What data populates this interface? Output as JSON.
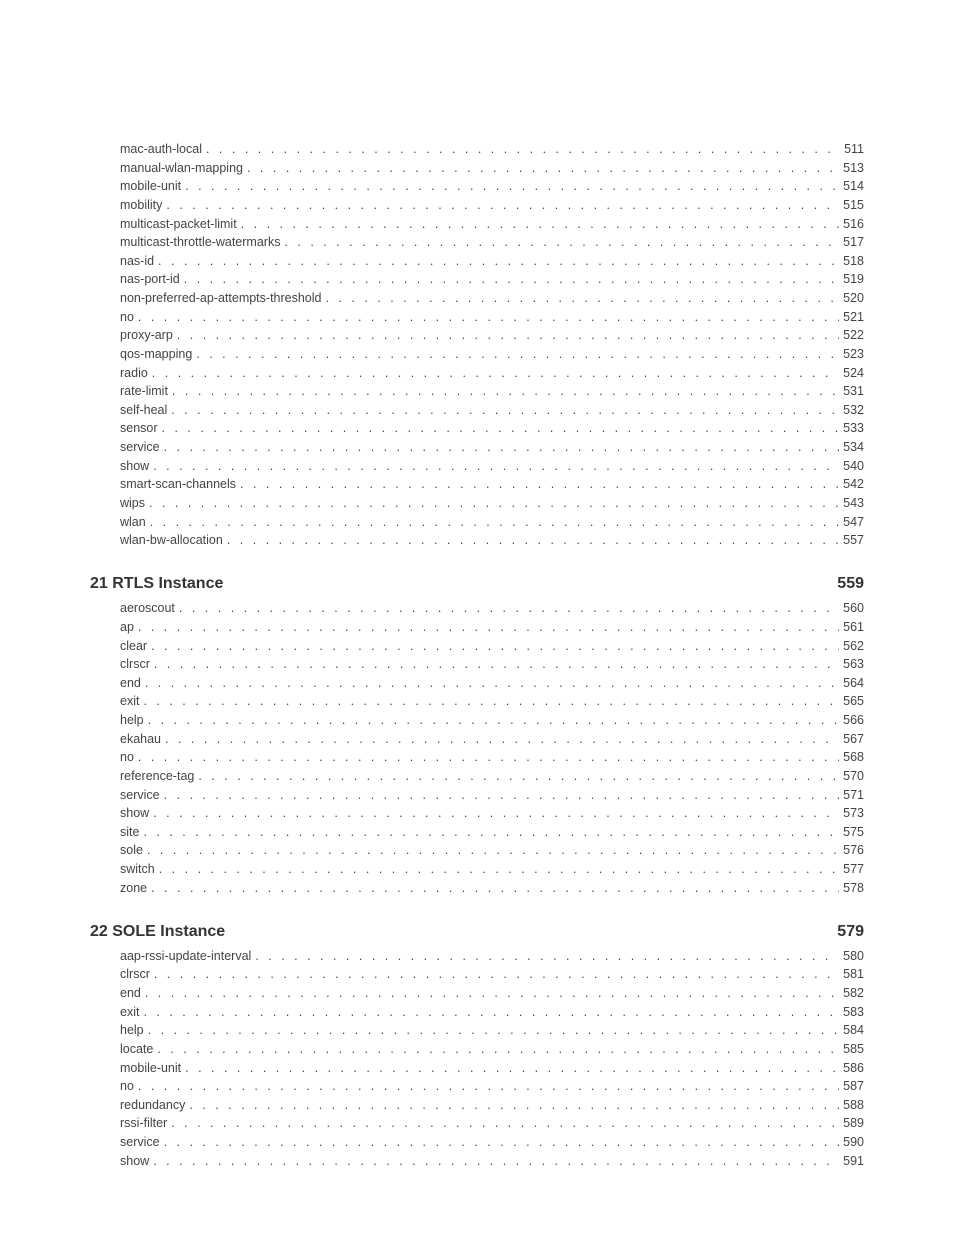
{
  "sections": [
    {
      "chapter": null,
      "entries": [
        {
          "label": "mac-auth-local",
          "page": "511"
        },
        {
          "label": "manual-wlan-mapping",
          "page": "513"
        },
        {
          "label": "mobile-unit",
          "page": "514"
        },
        {
          "label": "mobility",
          "page": "515"
        },
        {
          "label": "multicast-packet-limit",
          "page": "516"
        },
        {
          "label": "multicast-throttle-watermarks",
          "page": "517"
        },
        {
          "label": "nas-id",
          "page": "518"
        },
        {
          "label": "nas-port-id",
          "page": "519"
        },
        {
          "label": "non-preferred-ap-attempts-threshold",
          "page": "520"
        },
        {
          "label": "no",
          "page": "521"
        },
        {
          "label": "proxy-arp",
          "page": "522"
        },
        {
          "label": "qos-mapping",
          "page": "523"
        },
        {
          "label": "radio",
          "page": "524"
        },
        {
          "label": "rate-limit",
          "page": "531"
        },
        {
          "label": "self-heal",
          "page": "532"
        },
        {
          "label": "sensor",
          "page": "533"
        },
        {
          "label": "service",
          "page": "534"
        },
        {
          "label": "show",
          "page": "540"
        },
        {
          "label": "smart-scan-channels",
          "page": "542"
        },
        {
          "label": "wips",
          "page": "543"
        },
        {
          "label": "wlan",
          "page": "547"
        },
        {
          "label": "wlan-bw-allocation",
          "page": "557"
        }
      ]
    },
    {
      "chapter": {
        "title": "21 RTLS Instance",
        "page": "559"
      },
      "entries": [
        {
          "label": "aeroscout",
          "page": "560"
        },
        {
          "label": "ap",
          "page": "561"
        },
        {
          "label": "clear",
          "page": "562"
        },
        {
          "label": "clrscr",
          "page": "563"
        },
        {
          "label": "end",
          "page": "564"
        },
        {
          "label": "exit",
          "page": "565"
        },
        {
          "label": "help",
          "page": "566"
        },
        {
          "label": "ekahau",
          "page": "567"
        },
        {
          "label": "no",
          "page": "568"
        },
        {
          "label": "reference-tag",
          "page": "570"
        },
        {
          "label": "service",
          "page": "571"
        },
        {
          "label": "show",
          "page": "573"
        },
        {
          "label": "site",
          "page": "575"
        },
        {
          "label": "sole",
          "page": "576"
        },
        {
          "label": "switch",
          "page": "577"
        },
        {
          "label": "zone",
          "page": "578"
        }
      ]
    },
    {
      "chapter": {
        "title": "22 SOLE Instance",
        "page": "579"
      },
      "entries": [
        {
          "label": "aap-rssi-update-interval",
          "page": "580"
        },
        {
          "label": "clrscr",
          "page": "581"
        },
        {
          "label": "end",
          "page": "582"
        },
        {
          "label": "exit",
          "page": "583"
        },
        {
          "label": "help",
          "page": "584"
        },
        {
          "label": "locate",
          "page": "585"
        },
        {
          "label": "mobile-unit",
          "page": "586"
        },
        {
          "label": "no",
          "page": "587"
        },
        {
          "label": "redundancy",
          "page": "588"
        },
        {
          "label": "rssi-filter",
          "page": "589"
        },
        {
          "label": "service",
          "page": "590"
        },
        {
          "label": "show",
          "page": "591"
        }
      ]
    }
  ]
}
